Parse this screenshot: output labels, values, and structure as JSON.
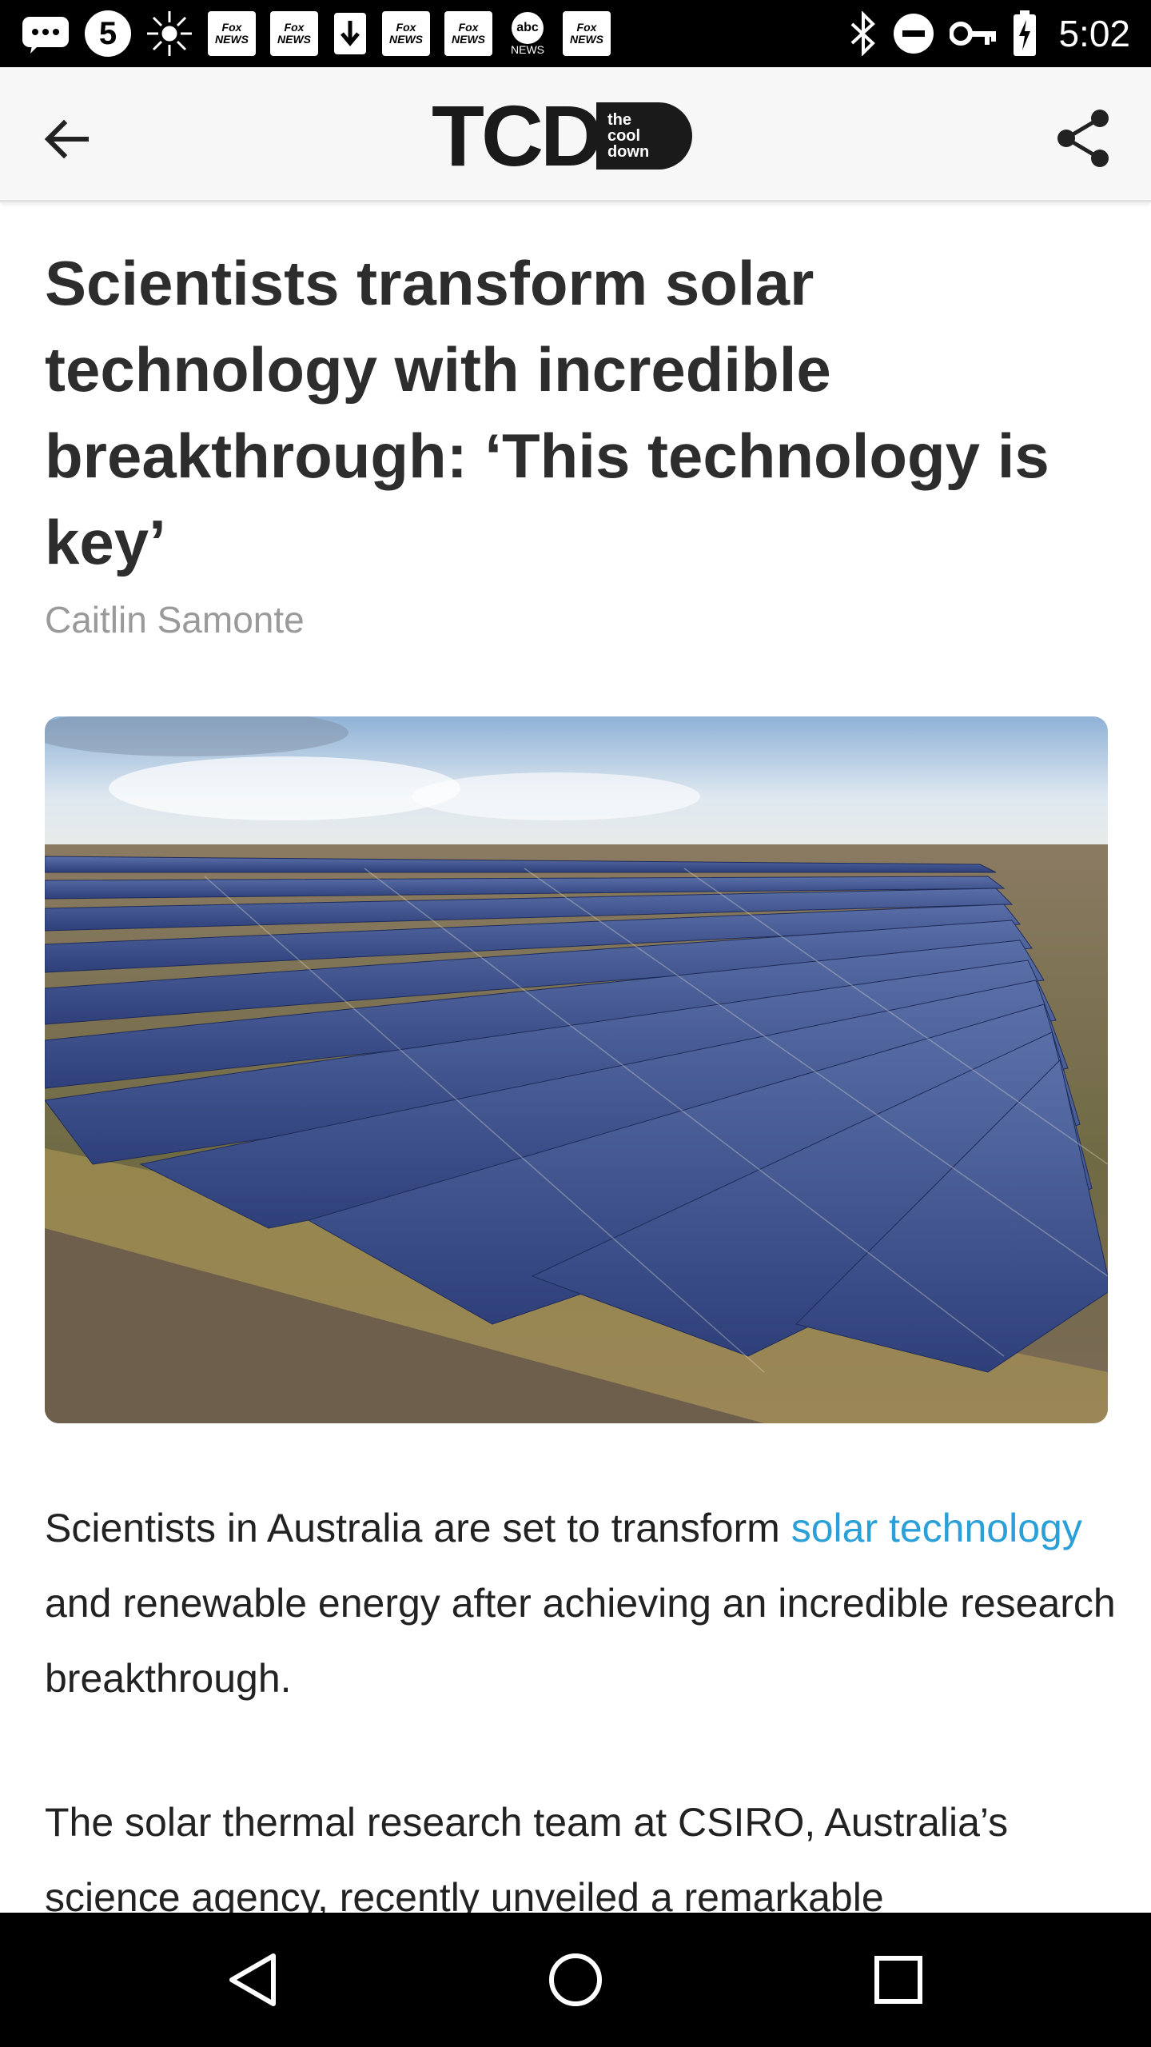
{
  "status_bar": {
    "time": "5:02",
    "left_icons": [
      "message-icon",
      "channel-5-icon",
      "radial-icon",
      "fox-news-icon",
      "fox-news-icon",
      "download-icon",
      "fox-news-icon",
      "fox-news-icon",
      "abc-news-icon",
      "fox-news-icon"
    ],
    "right_icons": [
      "bluetooth-icon",
      "do-not-disturb-icon",
      "key-icon",
      "battery-charging-icon"
    ],
    "channel_5": "5",
    "fox_news": "Fox NEWS",
    "abc_top": "abc",
    "abc_bottom": "NEWS"
  },
  "header": {
    "logo_letters": "TCD",
    "logo_pill": [
      "the",
      "cool",
      "down"
    ]
  },
  "article": {
    "headline": "Scientists transform solar technology with incredible breakthrough: ‘This technology is key’",
    "author": "Caitlin Samonte",
    "p1_before": "Scientists in Australia are set to transform ",
    "p1_link": "solar technology",
    "p1_after": " and renewable energy after achieving an incredible research breakthrough.",
    "p2": "The solar thermal research team at CSIRO, Australia’s science agency, recently unveiled a remarkable"
  },
  "colors": {
    "link": "#2a9fd8",
    "headline": "#2d2d2d",
    "byline": "#9a9a9a"
  }
}
